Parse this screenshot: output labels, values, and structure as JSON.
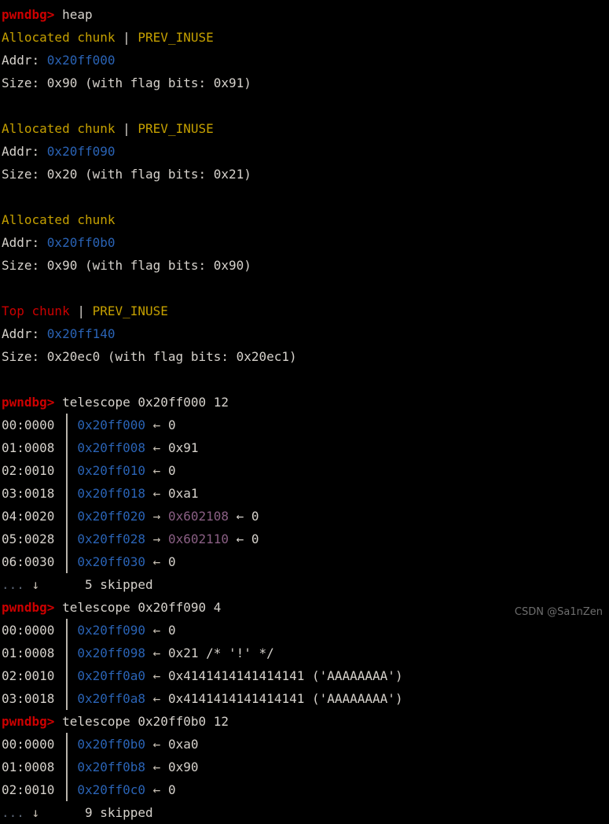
{
  "terminal": {
    "background": "#000000",
    "foreground": "#d6d2cc",
    "prompt_color": "#cc0000",
    "address_color": "#2a63b5",
    "chunk_label_color": "#c5a000",
    "top_chunk_color": "#cc0000",
    "heap_pointer_color": "#8a5f84"
  },
  "commands": {
    "heap": {
      "prompt": "pwndbg>",
      "text": "heap"
    },
    "telescope1": {
      "prompt": "pwndbg>",
      "text": "telescope 0x20ff000 12"
    },
    "telescope2": {
      "prompt": "pwndbg>",
      "text": "telescope 0x20ff090 4"
    },
    "telescope3": {
      "prompt": "pwndbg>",
      "text": "telescope 0x20ff0b0 12"
    }
  },
  "heap_chunks": [
    {
      "title": "Allocated chunk",
      "separator": " | ",
      "flags": "PREV_INUSE",
      "addr_label": "Addr: ",
      "addr": "0x20ff000",
      "size_line": "Size: 0x90 (with flag bits: 0x91)"
    },
    {
      "title": "Allocated chunk",
      "separator": " | ",
      "flags": "PREV_INUSE",
      "addr_label": "Addr: ",
      "addr": "0x20ff090",
      "size_line": "Size: 0x20 (with flag bits: 0x21)"
    },
    {
      "title": "Allocated chunk",
      "separator": "",
      "flags": "",
      "addr_label": "Addr: ",
      "addr": "0x20ff0b0",
      "size_line": "Size: 0x90 (with flag bits: 0x90)"
    },
    {
      "title": "Top chunk",
      "separator": " | ",
      "flags": "PREV_INUSE",
      "addr_label": "Addr: ",
      "addr": "0x20ff140",
      "size_line": "Size: 0x20ec0 (with flag bits: 0x20ec1)"
    }
  ],
  "telescope_blocks": [
    {
      "rows": [
        {
          "offset": "00:0000",
          "gap": "   ",
          "addr": "0x20ff000",
          "arrow": " ← ",
          "value": "0",
          "value_kind": "plain",
          "tail": ""
        },
        {
          "offset": "01:0008",
          "gap": "   ",
          "addr": "0x20ff008",
          "arrow": " ← ",
          "value": "0x91",
          "value_kind": "plain",
          "tail": ""
        },
        {
          "offset": "02:0010",
          "gap": "   ",
          "addr": "0x20ff010",
          "arrow": " ← ",
          "value": "0",
          "value_kind": "plain",
          "tail": ""
        },
        {
          "offset": "03:0018",
          "gap": "   ",
          "addr": "0x20ff018",
          "arrow": " ← ",
          "value": "0xa1",
          "value_kind": "plain",
          "tail": ""
        },
        {
          "offset": "04:0020",
          "gap": "   ",
          "addr": "0x20ff020",
          "arrow": " → ",
          "value": "0x602108",
          "value_kind": "heapptr",
          "tail": " ← 0"
        },
        {
          "offset": "05:0028",
          "gap": "   ",
          "addr": "0x20ff028",
          "arrow": " → ",
          "value": "0x602110",
          "value_kind": "heapptr",
          "tail": " ← 0"
        },
        {
          "offset": "06:0030",
          "gap": "   ",
          "addr": "0x20ff030",
          "arrow": " ← ",
          "value": "0",
          "value_kind": "plain",
          "tail": ""
        }
      ],
      "skipped": {
        "dots": "... ",
        "down": "↓",
        "pad": "      ",
        "text": "5 skipped"
      }
    },
    {
      "rows": [
        {
          "offset": "00:0000",
          "gap": "   ",
          "addr": "0x20ff090",
          "arrow": " ← ",
          "value": "0",
          "value_kind": "plain",
          "tail": ""
        },
        {
          "offset": "01:0008",
          "gap": "   ",
          "addr": "0x20ff098",
          "arrow": " ← ",
          "value": "0x21 /* '!' */",
          "value_kind": "plain",
          "tail": ""
        },
        {
          "offset": "02:0010",
          "gap": "   ",
          "addr": "0x20ff0a0",
          "arrow": " ← ",
          "value": "0x4141414141414141 ('AAAAAAAA')",
          "value_kind": "plain",
          "tail": ""
        },
        {
          "offset": "03:0018",
          "gap": "   ",
          "addr": "0x20ff0a8",
          "arrow": " ← ",
          "value": "0x4141414141414141 ('AAAAAAAA')",
          "value_kind": "plain",
          "tail": ""
        }
      ],
      "skipped": null
    },
    {
      "rows": [
        {
          "offset": "00:0000",
          "gap": "   ",
          "addr": "0x20ff0b0",
          "arrow": " ← ",
          "value": "0xa0",
          "value_kind": "plain",
          "tail": ""
        },
        {
          "offset": "01:0008",
          "gap": "   ",
          "addr": "0x20ff0b8",
          "arrow": " ← ",
          "value": "0x90",
          "value_kind": "plain",
          "tail": ""
        },
        {
          "offset": "02:0010",
          "gap": "   ",
          "addr": "0x20ff0c0",
          "arrow": " ← ",
          "value": "0",
          "value_kind": "plain",
          "tail": ""
        }
      ],
      "skipped": {
        "dots": "... ",
        "down": "↓",
        "pad": "      ",
        "text": "9 skipped"
      }
    }
  ],
  "watermark": "CSDN @Sa1nZen"
}
